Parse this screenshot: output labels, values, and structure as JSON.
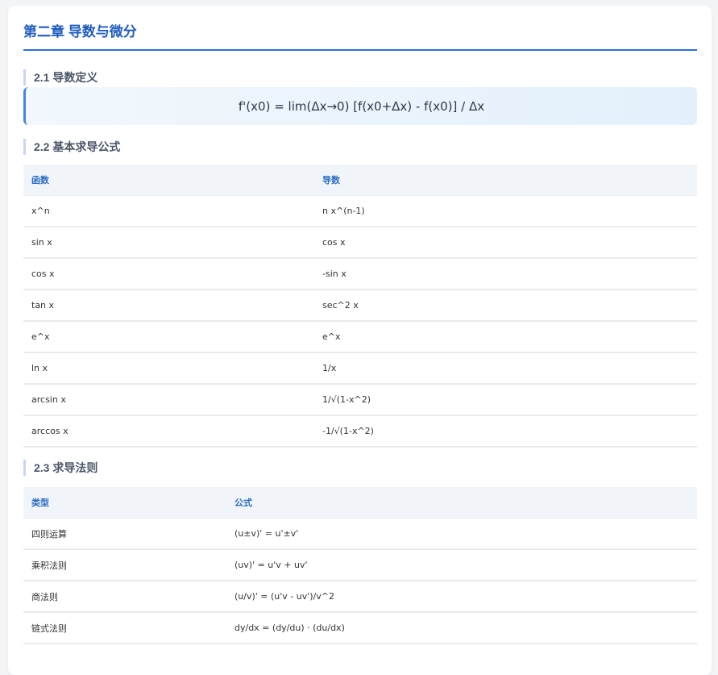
{
  "chapter": {
    "title": "第二章 导数与微分"
  },
  "section_1": {
    "title": "2.1 导数定义",
    "formula": "f'(x0) = lim(Δx→0) [f(x0+Δx) - f(x0)] / Δx"
  },
  "section_2": {
    "title": "2.2 基本求导公式",
    "headers": [
      "函数",
      "导数"
    ],
    "rows": [
      [
        "x^n",
        "n x^(n-1)"
      ],
      [
        "sin x",
        "cos x"
      ],
      [
        "cos x",
        "-sin x"
      ],
      [
        "tan x",
        "sec^2 x"
      ],
      [
        "e^x",
        "e^x"
      ],
      [
        "ln x",
        "1/x"
      ],
      [
        "arcsin x",
        "1/√(1-x^2)"
      ],
      [
        "arccos x",
        "-1/√(1-x^2)"
      ]
    ]
  },
  "section_3": {
    "title": "2.3 求导法则",
    "headers": [
      "类型",
      "公式"
    ],
    "rows": [
      [
        "四则运算",
        "(u±v)' = u'±v'"
      ],
      [
        "乘积法则",
        "(uv)' = u'v + uv'"
      ],
      [
        "商法则",
        "(u/v)' = (u'v - uv')/v^2"
      ],
      [
        "链式法则",
        "dy/dx = (dy/du) · (du/dx)"
      ]
    ]
  },
  "colors": {
    "accent": "#1f5cbf",
    "header_text": "#2b6cc4",
    "header_bg": "#f1f5f9"
  }
}
